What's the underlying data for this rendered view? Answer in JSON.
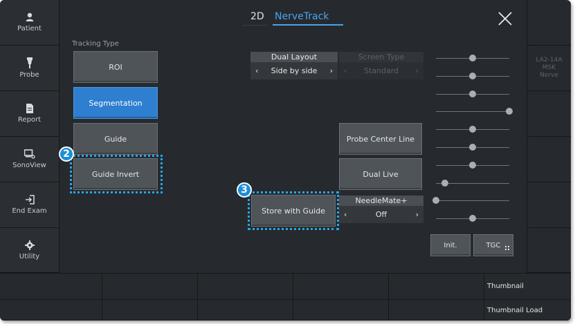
{
  "sidebar": {
    "items": [
      {
        "label": "Patient",
        "icon": "person-icon"
      },
      {
        "label": "Probe",
        "icon": "probe-icon"
      },
      {
        "label": "Report",
        "icon": "document-icon"
      },
      {
        "label": "SonoView",
        "icon": "sonoview-icon"
      },
      {
        "label": "End Exam",
        "icon": "exit-icon"
      },
      {
        "label": "Utility",
        "icon": "gear-icon"
      }
    ]
  },
  "tabs": {
    "tab_2d": "2D",
    "tab_nervetrack": "NerveTrack",
    "active": "NerveTrack"
  },
  "tracking": {
    "section_label": "Tracking Type",
    "roi": "ROI",
    "segmentation": "Segmentation",
    "guide": "Guide",
    "guide_invert": "Guide Invert",
    "selected": "Segmentation"
  },
  "dual_layout": {
    "header": "Dual Layout",
    "value": "Side by side"
  },
  "screen_type": {
    "header": "Screen Type",
    "value": "Standard",
    "enabled": false
  },
  "buttons": {
    "probe_center_line": "Probe Center Line",
    "dual_live": "Dual Live",
    "store_with_guide": "Store with Guide"
  },
  "needlemate": {
    "header": "NeedleMate+",
    "value": "Off"
  },
  "tgc_sliders": [
    0.5,
    0.5,
    0.5,
    1.0,
    0.5,
    0.5,
    0.5,
    0.12,
    0.0,
    0.5
  ],
  "bottom": {
    "init": "Init.",
    "tgc": "TGC"
  },
  "probe_info": {
    "model": "LA2-14A",
    "preset_1": "MSK",
    "preset_2": "Nerve"
  },
  "thumbnails": {
    "thumbnail": "Thumbnail",
    "thumbnail_load": "Thumbnail Load"
  },
  "callouts": {
    "c2": "2",
    "c3": "3"
  },
  "colors": {
    "accent": "#2f7fd0",
    "highlight": "#2aa6e8",
    "background": "#262a2e"
  },
  "close_icon": "close-icon"
}
